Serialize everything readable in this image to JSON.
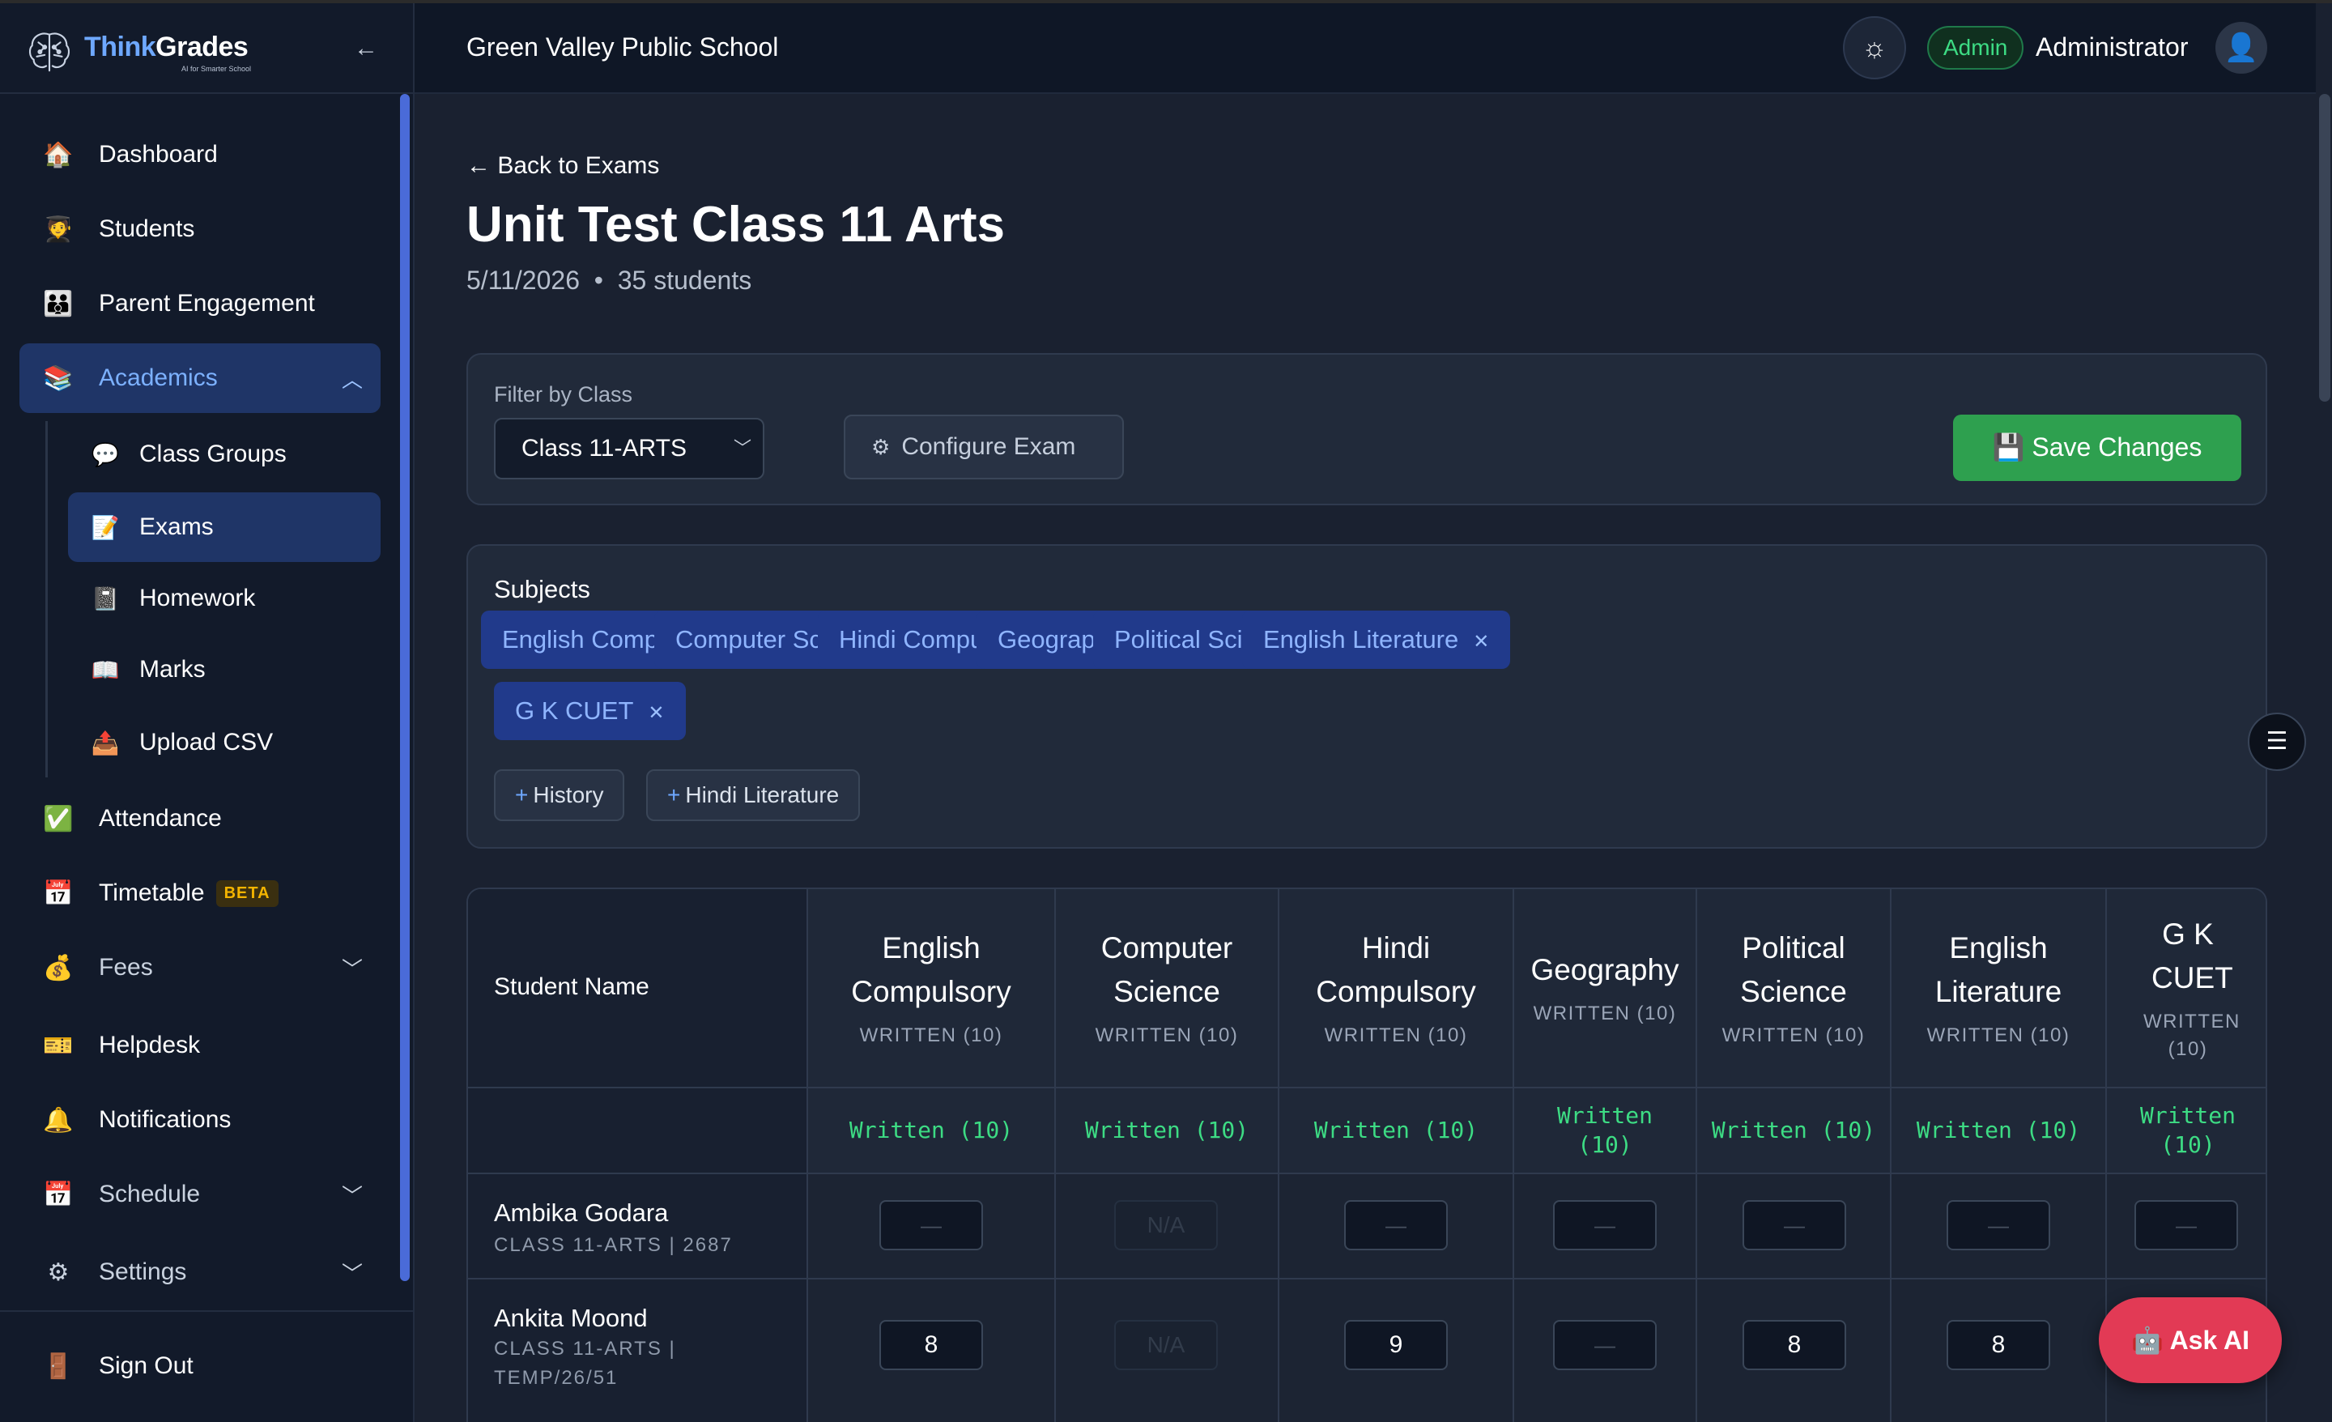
{
  "brand": {
    "think": "Think",
    "grades": "Grades",
    "tagline": "AI for Smarter School"
  },
  "sidebar": {
    "items": [
      {
        "label": "Dashboard",
        "icon": "🏠"
      },
      {
        "label": "Students",
        "icon": "👨‍🎓"
      },
      {
        "label": "Parent Engagement",
        "icon": "👪"
      },
      {
        "label": "Academics",
        "icon": "📚"
      },
      {
        "label": "Attendance",
        "icon": "✅"
      },
      {
        "label": "Timetable",
        "icon": "📅",
        "badge": "BETA"
      },
      {
        "label": "Fees",
        "icon": "💰"
      },
      {
        "label": "Helpdesk",
        "icon": "🎫"
      },
      {
        "label": "Notifications",
        "icon": "🔔"
      },
      {
        "label": "Schedule",
        "icon": "📅"
      },
      {
        "label": "Settings",
        "icon": "⚙"
      },
      {
        "label": "Sign Out",
        "icon": "🚪"
      }
    ],
    "sub_items": [
      {
        "label": "Class Groups",
        "icon": "💬"
      },
      {
        "label": "Exams",
        "icon": "📝"
      },
      {
        "label": "Homework",
        "icon": "📓"
      },
      {
        "label": "Marks",
        "icon": "📖"
      },
      {
        "label": "Upload CSV",
        "icon": "📤"
      }
    ]
  },
  "header": {
    "school": "Green Valley Public School",
    "role": "Admin",
    "user": "Administrator"
  },
  "page": {
    "back": "← Back to Exams",
    "title": "Unit Test Class 11 Arts",
    "date": "5/11/2026",
    "students": "35 students"
  },
  "filter": {
    "label": "Filter by Class",
    "selected": "Class 11-ARTS",
    "configure": "Configure Exam",
    "save": "💾 Save Changes"
  },
  "subjects": {
    "title": "Subjects",
    "selected": [
      "English Compulsory",
      "Computer Science",
      "Hindi Compulsory",
      "Geography",
      "Political Science",
      "English Literature",
      "G K CUET"
    ],
    "available": [
      "History",
      "Hindi Literature"
    ]
  },
  "table": {
    "name_header": "Student Name",
    "columns": [
      {
        "title": "English Compulsory",
        "sub": "WRITTEN (10)",
        "written": "Written (10)"
      },
      {
        "title": "Computer Science",
        "sub": "WRITTEN (10)",
        "written": "Written (10)"
      },
      {
        "title": "Hindi Compulsory",
        "sub": "WRITTEN (10)",
        "written": "Written (10)"
      },
      {
        "title": "Geography",
        "sub": "WRITTEN (10)",
        "written": "Written (10)"
      },
      {
        "title": "Political Science",
        "sub": "WRITTEN (10)",
        "written": "Written (10)"
      },
      {
        "title": "English Literature",
        "sub": "WRITTEN (10)",
        "written": "Written (10)"
      },
      {
        "title": "G K CUET",
        "sub": "WRITTEN (10)",
        "written": "Written (10)"
      }
    ],
    "rows": [
      {
        "name": "Ambika Godara",
        "sub": "CLASS 11-ARTS | 2687",
        "marks": [
          "—",
          "N/A",
          "—",
          "—",
          "—",
          "—",
          "—"
        ]
      },
      {
        "name": "Ankita Moond",
        "sub": "CLASS 11-ARTS | TEMP/26/51",
        "marks": [
          "8",
          "N/A",
          "9",
          "—",
          "8",
          "8",
          ""
        ]
      }
    ]
  },
  "ask_ai": "Ask AI"
}
